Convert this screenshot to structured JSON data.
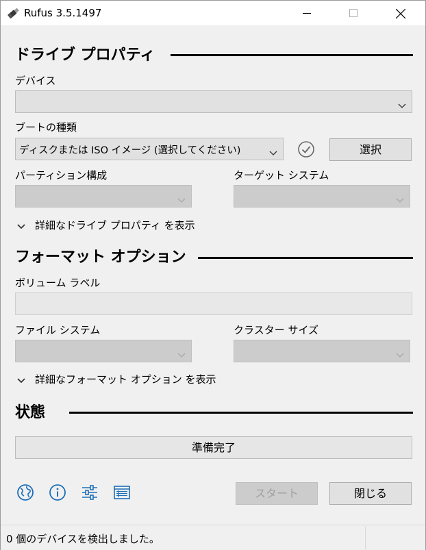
{
  "window": {
    "title": "Rufus 3.5.1497"
  },
  "drive_properties": {
    "heading": "ドライブ プロパティ",
    "device_label": "デバイス",
    "device_value": "",
    "boot_type_label": "ブートの種類",
    "boot_type_value": "ディスクまたは ISO イメージ (選択してください)",
    "select_button": "選択",
    "partition_scheme_label": "パーティション構成",
    "partition_scheme_value": "",
    "target_system_label": "ターゲット システム",
    "target_system_value": "",
    "advanced_toggle": "詳細なドライブ プロパティ を表示"
  },
  "format_options": {
    "heading": "フォーマット オプション",
    "volume_label_label": "ボリューム ラベル",
    "volume_label_value": "",
    "file_system_label": "ファイル システム",
    "file_system_value": "",
    "cluster_size_label": "クラスター サイズ",
    "cluster_size_value": "",
    "advanced_toggle": "詳細なフォーマット オプション を表示"
  },
  "status": {
    "heading": "状態",
    "progress_text": "準備完了"
  },
  "actions": {
    "start_button": "スタート",
    "close_button": "閉じる"
  },
  "toolbar": {
    "icons": [
      "globe-icon",
      "info-icon",
      "settings-sliders-icon",
      "log-icon"
    ]
  },
  "statusbar": {
    "message": "0 個のデバイスを検出しました。"
  },
  "colors": {
    "icon_blue": "#1c6fb8",
    "rule": "#000000",
    "disabled_text": "#a0a0a0"
  }
}
